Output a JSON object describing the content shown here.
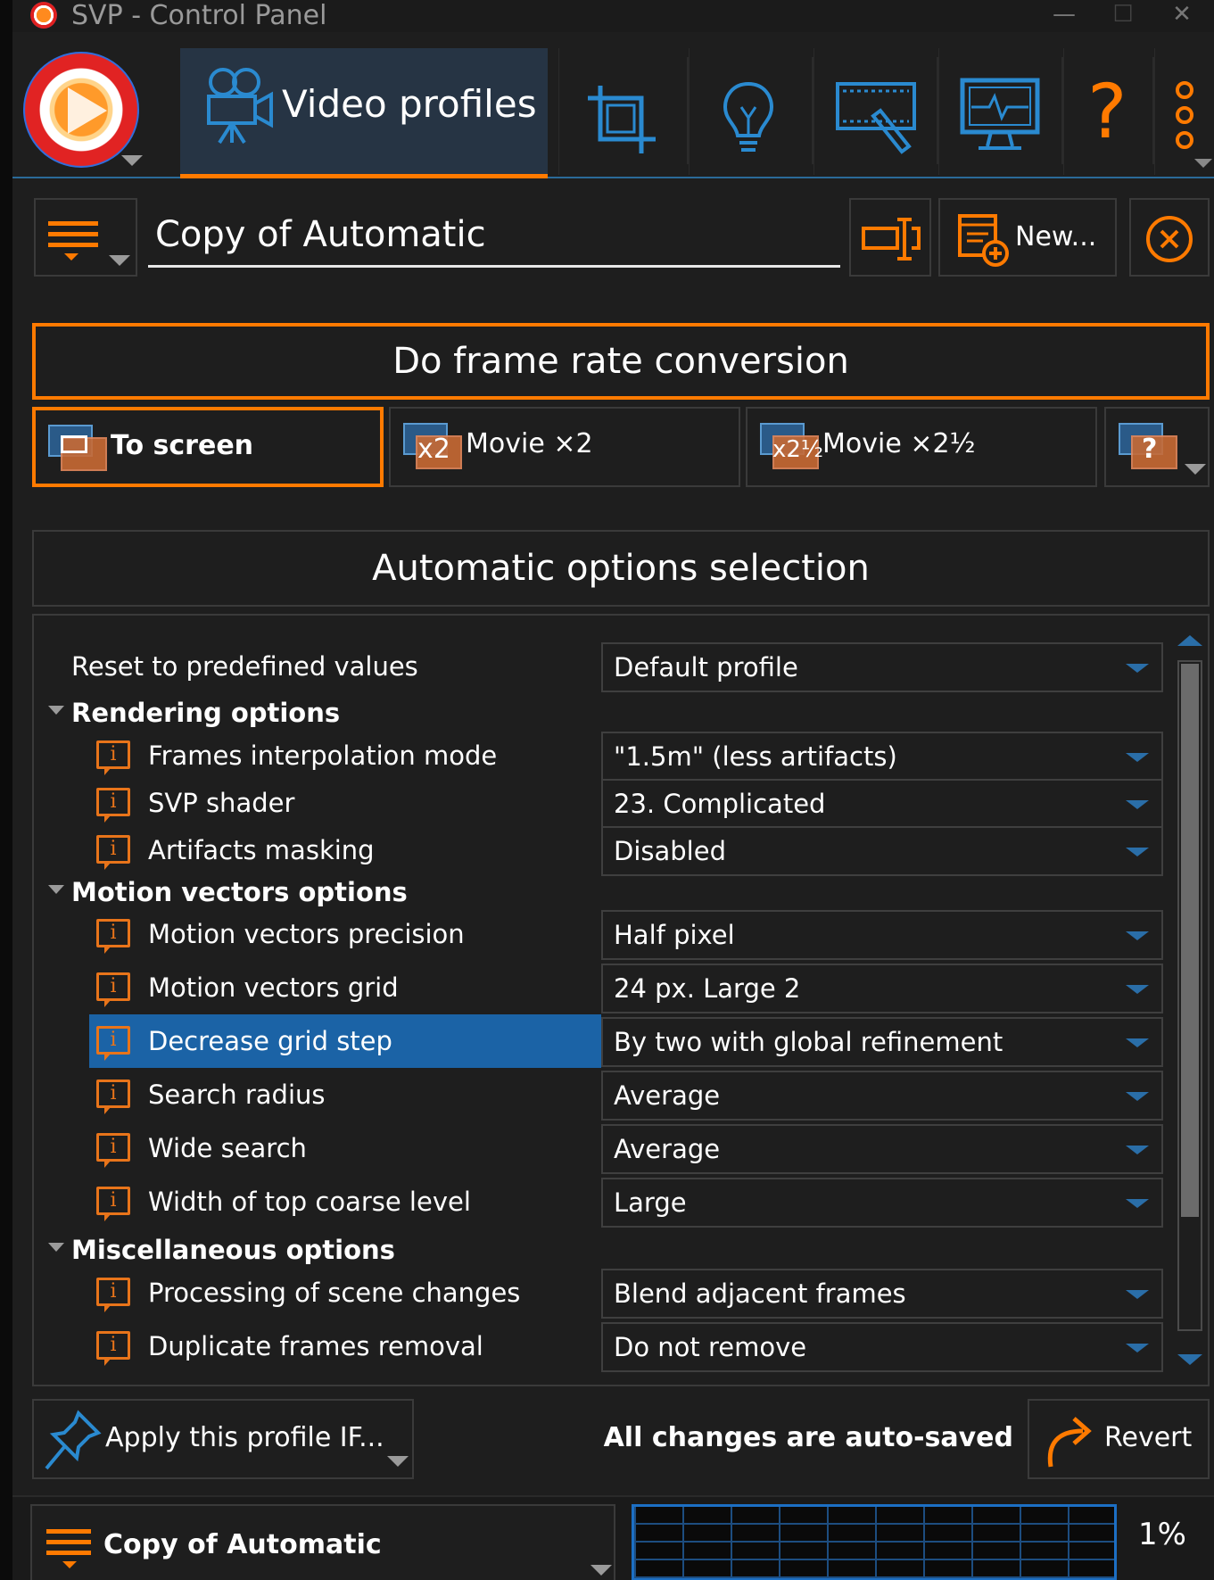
{
  "window": {
    "title": "SVP - Control Panel",
    "minimize": "—",
    "maximize": "☐",
    "close": "✕"
  },
  "nav": {
    "active_tab": "Video profiles",
    "tabs": [
      "video-profiles",
      "crop",
      "lightbulb",
      "video-edit",
      "monitor"
    ],
    "help": "?",
    "accent": "#ff7a00",
    "icon_color": "#2a8ad0"
  },
  "profile": {
    "name": "Copy of Automatic",
    "new_label": "New..."
  },
  "frame_rate": {
    "title": "Do frame rate conversion",
    "modes": [
      {
        "label": "To screen",
        "icon_text": "",
        "selected": true
      },
      {
        "label": "Movie ×2",
        "icon_text": "x2",
        "selected": false
      },
      {
        "label": "Movie ×2½",
        "icon_text": "x2½",
        "selected": false
      },
      {
        "label": "",
        "icon_text": "?",
        "selected": false
      }
    ]
  },
  "auto_options": {
    "title": "Automatic options selection"
  },
  "options": {
    "reset": {
      "label": "Reset to predefined values",
      "value": "Default profile"
    },
    "groups": [
      {
        "title": "Rendering options"
      },
      {
        "title": "Motion vectors options"
      },
      {
        "title": "Miscellaneous options"
      }
    ],
    "rows": [
      {
        "label": "Frames interpolation mode",
        "value": "\"1.5m\" (less artifacts)"
      },
      {
        "label": "SVP shader",
        "value": "23. Complicated"
      },
      {
        "label": "Artifacts masking",
        "value": "Disabled"
      },
      {
        "label": "Motion vectors precision",
        "value": "Half pixel"
      },
      {
        "label": "Motion vectors grid",
        "value": "24 px. Large 2"
      },
      {
        "label": "Decrease grid step",
        "value": "By two with global refinement"
      },
      {
        "label": "Search radius",
        "value": "Average"
      },
      {
        "label": "Wide search",
        "value": "Average"
      },
      {
        "label": "Width of top coarse level",
        "value": "Large"
      },
      {
        "label": "Processing of scene changes",
        "value": "Blend adjacent frames"
      },
      {
        "label": "Duplicate frames removal",
        "value": "Do not remove"
      }
    ],
    "info_icon": "i",
    "highlight_color": "#1b63a6"
  },
  "footer": {
    "apply_label": "Apply this profile IF...",
    "autosave_text": "All changes are auto-saved",
    "revert_label": "Revert"
  },
  "status": {
    "profile_name": "Copy of Automatic",
    "cpu": "1%"
  }
}
